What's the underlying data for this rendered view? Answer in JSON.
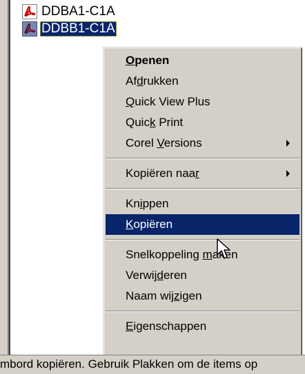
{
  "files": [
    {
      "name": "DDBA1-C1A",
      "icon": "pdf-icon",
      "selected": false
    },
    {
      "name": "DDBB1-C1A",
      "icon": "pdf-icon",
      "selected": true
    }
  ],
  "context_menu": {
    "items": [
      {
        "pre": "",
        "u": "O",
        "post": "penen",
        "bold": true
      },
      {
        "pre": "Af",
        "u": "d",
        "post": "rukken"
      },
      {
        "pre": "",
        "u": "Q",
        "post": "uick View Plus"
      },
      {
        "pre": "Quic",
        "u": "k",
        "post": " Print"
      },
      {
        "pre": "Corel ",
        "u": "V",
        "post": "ersions",
        "submenu": true
      },
      {
        "pre": "Kopiëren naa",
        "u": "r",
        "post": "",
        "submenu": true
      },
      {
        "pre": "Kn",
        "u": "i",
        "post": "ppen"
      },
      {
        "pre": "",
        "u": "K",
        "post": "opiëren",
        "highlighted": true
      },
      {
        "pre": "Snelkoppeling ",
        "u": "m",
        "post": "aken"
      },
      {
        "pre": "Verwij",
        "u": "d",
        "post": "eren"
      },
      {
        "pre": "Naam wij",
        "u": "z",
        "post": "igen"
      },
      {
        "pre": "",
        "u": "E",
        "post": "igenschappen"
      }
    ]
  },
  "statusbar": {
    "text": "mbord kopiëren. Gebruik Plakken om de items op"
  },
  "colors": {
    "highlight": "#0a246a",
    "face": "#d4d0c8"
  }
}
